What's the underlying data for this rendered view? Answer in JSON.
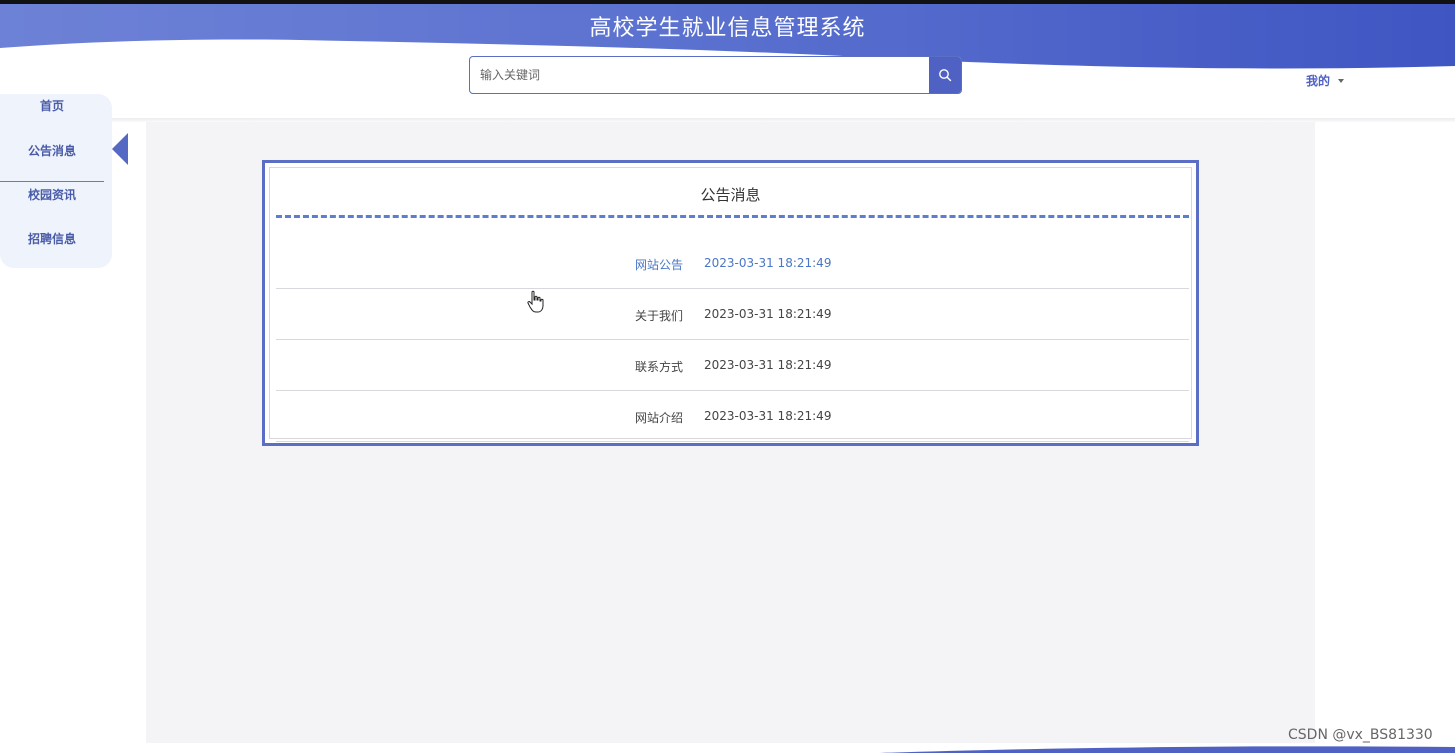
{
  "header": {
    "title": "高校学生就业信息管理系统",
    "search_placeholder": "输入关键词",
    "user_menu_label": "我的"
  },
  "sidebar": {
    "items": [
      {
        "label": "首页"
      },
      {
        "label": "公告消息",
        "active": true
      },
      {
        "label": "校园资讯"
      },
      {
        "label": "招聘信息"
      }
    ]
  },
  "panel": {
    "title": "公告消息",
    "rows": [
      {
        "title": "网站公告",
        "date": "2023-03-31 18:21:49"
      },
      {
        "title": "关于我们",
        "date": "2023-03-31 18:21:49"
      },
      {
        "title": "联系方式",
        "date": "2023-03-31 18:21:49"
      },
      {
        "title": "网站介绍",
        "date": "2023-03-31 18:21:49"
      }
    ]
  },
  "watermark": "CSDN @vx_BS81330",
  "colors": {
    "brand": "#4f62c3",
    "header_gradient_start": "#6d82d6",
    "header_gradient_end": "#3f55c2",
    "highlight_text": "#4a76c6",
    "main_bg": "#f4f4f6"
  }
}
